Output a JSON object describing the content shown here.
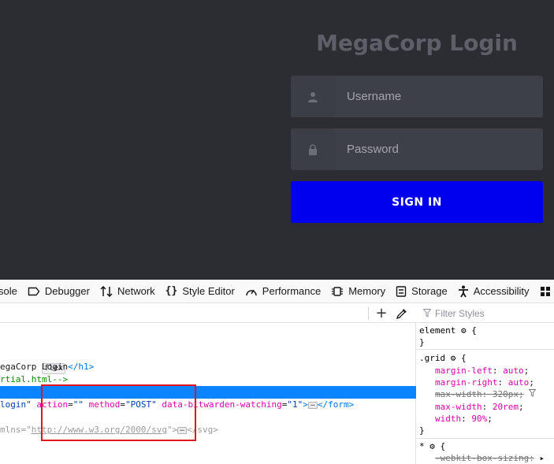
{
  "login": {
    "title": "MegaCorp Login",
    "username_placeholder": "Username",
    "password_placeholder": "Password",
    "signin_label": "SIGN IN"
  },
  "devtools": {
    "tabs": [
      {
        "label": "Console",
        "visible_label": "sole",
        "icon": "console-icon"
      },
      {
        "label": "Debugger",
        "icon": "debugger-icon"
      },
      {
        "label": "Network",
        "icon": "network-icon"
      },
      {
        "label": "Style Editor",
        "icon": "style-editor-icon"
      },
      {
        "label": "Performance",
        "icon": "performance-icon"
      },
      {
        "label": "Memory",
        "icon": "memory-icon"
      },
      {
        "label": "Storage",
        "icon": "storage-icon"
      },
      {
        "label": "Accessibility",
        "icon": "accessibility-icon"
      }
    ],
    "inspector": {
      "flex_badge": "flex",
      "h1_text": "egaCorp Login",
      "h1_close": "</h1>",
      "comment_text": "rtial.html-->",
      "form_line": {
        "p1": "login\"",
        "action_attr": "action",
        "action_val": "\"\"",
        "method_attr": "method",
        "method_val": "\"POST\"",
        "dbw_attr": "data-bitwarden-watching",
        "dbw_val": "\"1\"",
        "close": "</form>"
      },
      "svg_line": {
        "p1": "mlns=\"",
        "url": "http://www.w3.org/2000/svg",
        "p2": "\">",
        "close": "</svg>"
      }
    },
    "rules": {
      "filter_placeholder": "Filter Styles",
      "element_selector": "element",
      "grid_selector": ".grid",
      "declarations": [
        {
          "prop": "margin-left",
          "value": "auto"
        },
        {
          "prop": "margin-right",
          "value": "auto"
        },
        {
          "prop": "max-width",
          "value": "320px",
          "overridden": true
        },
        {
          "prop": "max-width",
          "value": "20rem"
        },
        {
          "prop": "width",
          "value": "90%"
        }
      ],
      "star_selector": "*",
      "webkit_prop": "-webkit-box-sizing:"
    }
  },
  "colors": {
    "page_bg": "#2b2d33",
    "field_bg": "#3d4047",
    "button_bg": "#0000ee",
    "selection": "#0a84ff",
    "highlight_box": "#e3141b"
  }
}
